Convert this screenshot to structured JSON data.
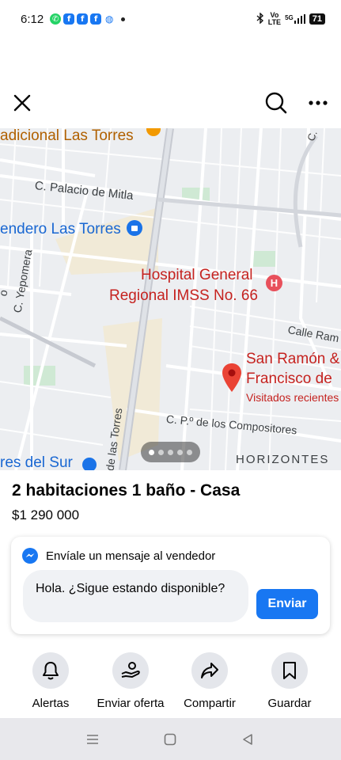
{
  "status_bar": {
    "time": "6:12",
    "notification_icons": [
      "whatsapp-icon",
      "facebook-icon",
      "facebook-icon",
      "facebook-icon",
      "messenger-icon"
    ],
    "network_label_top": "Vo",
    "network_label_bottom": "LTE",
    "signal_label": "5G",
    "battery": "71"
  },
  "header": {
    "close_icon": "close-icon",
    "search_icon": "search-icon",
    "more_icon": "more-options-icon"
  },
  "map": {
    "labels": {
      "top_left": "adicional Las Torres",
      "street_mitla": "C. Palacio de Mitla",
      "place_sendero": "endero Las Torres",
      "street_yepomera": "C. Yepomera",
      "hospital_line1": "Hospital General",
      "hospital_line2": "Regional IMSS No. 66",
      "street_ram": "Calle Ram",
      "pin_line1": "San Ramón &",
      "pin_line2": "Francisco de",
      "pin_line3": "Visitados recientes",
      "street_compositores": "C. P.º de los Compositores",
      "street_torres": "de las Torres",
      "bottom_left": "res del Sur",
      "horizontes": "HORIZONTES",
      "top_right_c": "C.",
      "left_o": "o"
    },
    "carousel": {
      "count": 5,
      "active": 1
    }
  },
  "listing": {
    "title": "2 habitaciones 1 baño - Casa",
    "price": "$1 290 000"
  },
  "message": {
    "heading": "Envíale un mensaje al vendedor",
    "input_value": "Hola. ¿Sigue estando disponible?",
    "send_label": "Enviar"
  },
  "actions": [
    {
      "label": "Alertas",
      "icon": "bell-icon"
    },
    {
      "label": "Enviar oferta",
      "icon": "offer-icon"
    },
    {
      "label": "Compartir",
      "icon": "share-icon"
    },
    {
      "label": "Guardar",
      "icon": "bookmark-icon"
    }
  ],
  "nav_bar": {
    "icons": [
      "menu-icon",
      "home-square-icon",
      "back-triangle-icon"
    ]
  },
  "colors": {
    "accent": "#1877f2",
    "map_red": "#d93025",
    "map_blue": "#1a73e8",
    "map_bg": "#eceef1"
  }
}
